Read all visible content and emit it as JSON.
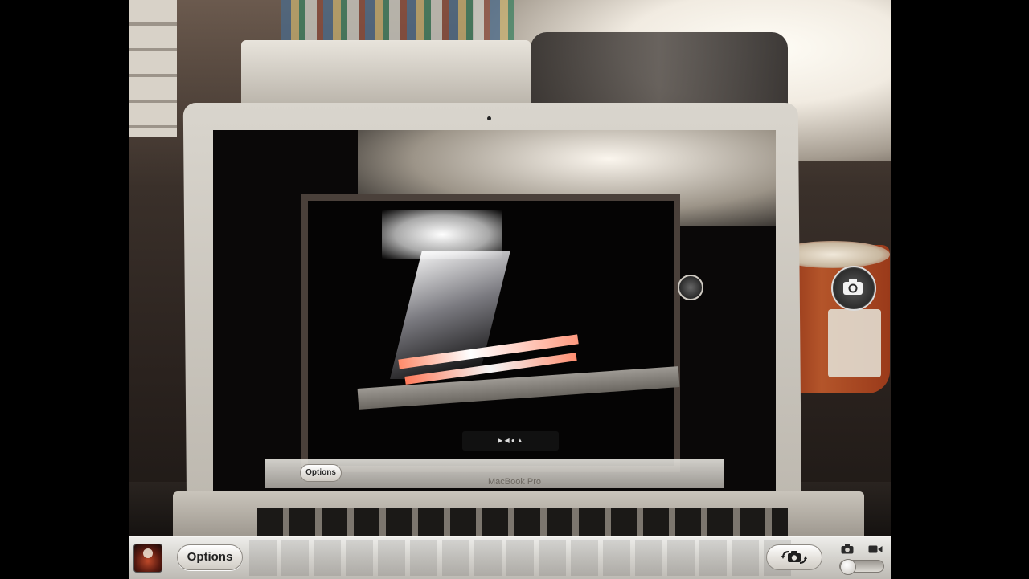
{
  "scene": {
    "laptop_brand": "MacBook Pro",
    "nested_options_label": "Options"
  },
  "toolbar": {
    "options_label": "Options",
    "camera_switch_icon": "camera-rotate-icon",
    "photo_mode_icon": "camera-icon",
    "video_mode_icon": "video-camera-icon",
    "thumbnail_icon": "last-photo-thumbnail"
  },
  "shutter": {
    "icon": "camera-icon"
  },
  "colors": {
    "toolbar_top": "#eeedea",
    "toolbar_bottom": "#bdbab4",
    "letterbox": "#000000"
  }
}
